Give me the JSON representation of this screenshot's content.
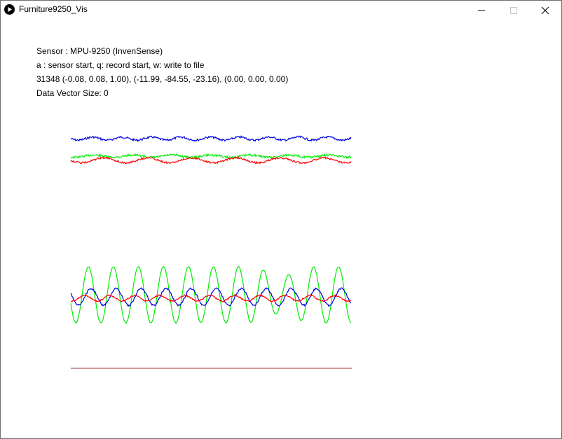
{
  "window": {
    "title": "Furniture9250_Vis",
    "controls": {
      "minimize_icon": "minimize-icon",
      "maximize_icon": "maximize-icon",
      "close_icon": "close-icon"
    }
  },
  "info": {
    "sensor_line": "Sensor : MPU-9250 (InvenSense)",
    "keys_line": "a : sensor start, q: record start, w: write to file",
    "values_line": "31348 (-0.08, 0.08, 1.00), (-11.99, -84.55, -23.16), (0.00, 0.00, 0.00)",
    "vector_line": "Data Vector Size: 0"
  },
  "colors": {
    "x_axis": "#ff0000",
    "y_axis": "#00ee00",
    "z_axis": "#0000dd",
    "baseline": "#a03030"
  }
}
